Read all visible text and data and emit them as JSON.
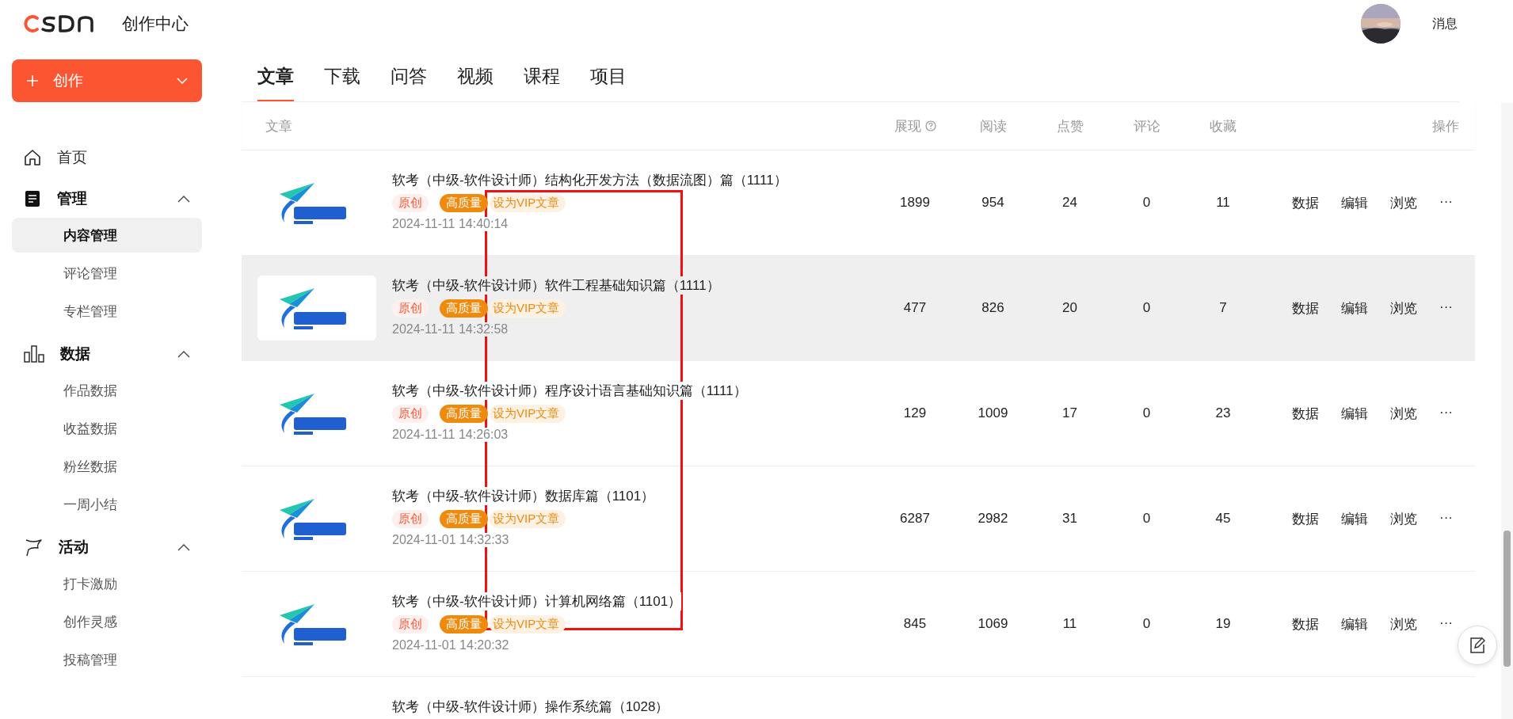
{
  "header": {
    "brand": "创作中心",
    "messages": "消息"
  },
  "create_button": {
    "label": "创作"
  },
  "sidebar": {
    "items": [
      {
        "label": "首页",
        "expanded": false
      },
      {
        "label": "管理",
        "expanded": true,
        "children": [
          {
            "label": "内容管理",
            "selected": true
          },
          {
            "label": "评论管理",
            "selected": false
          },
          {
            "label": "专栏管理",
            "selected": false
          }
        ]
      },
      {
        "label": "数据",
        "expanded": true,
        "children": [
          {
            "label": "作品数据",
            "selected": false
          },
          {
            "label": "收益数据",
            "selected": false
          },
          {
            "label": "粉丝数据",
            "selected": false
          },
          {
            "label": "一周小结",
            "selected": false
          }
        ]
      },
      {
        "label": "活动",
        "expanded": true,
        "children": [
          {
            "label": "打卡激励",
            "selected": false
          },
          {
            "label": "创作灵感",
            "selected": false
          },
          {
            "label": "投稿管理",
            "selected": false
          }
        ]
      }
    ]
  },
  "tabs": [
    {
      "label": "文章",
      "selected": true
    },
    {
      "label": "下载",
      "selected": false
    },
    {
      "label": "问答",
      "selected": false
    },
    {
      "label": "视频",
      "selected": false
    },
    {
      "label": "课程",
      "selected": false
    },
    {
      "label": "项目",
      "selected": false
    }
  ],
  "table": {
    "columns": [
      "文章",
      "展现",
      "阅读",
      "点赞",
      "评论",
      "收藏",
      "操作"
    ],
    "rows": [
      {
        "title": "软考（中级-软件设计师）结构化开发方法（数据流图）篇（1111）",
        "tags": [
          {
            "label": "原创",
            "kind": "original"
          },
          {
            "label": "高质量",
            "kind": "quality"
          },
          {
            "label": "设为VIP文章",
            "kind": "vip"
          }
        ],
        "date": "2024-11-11 14:40:14",
        "views": "1899",
        "reads": "954",
        "likes": "24",
        "comments": "0",
        "favorites": "11",
        "actions": [
          "数据",
          "编辑",
          "浏览",
          "···"
        ],
        "highlighted": false
      },
      {
        "title": "软考（中级-软件设计师）软件工程基础知识篇（1111）",
        "tags": [
          {
            "label": "原创",
            "kind": "original"
          },
          {
            "label": "高质量",
            "kind": "quality"
          },
          {
            "label": "设为VIP文章",
            "kind": "vip"
          }
        ],
        "date": "2024-11-11 14:32:58",
        "views": "477",
        "reads": "826",
        "likes": "20",
        "comments": "0",
        "favorites": "7",
        "actions": [
          "数据",
          "编辑",
          "浏览",
          "···"
        ],
        "highlighted": true
      },
      {
        "title": "软考（中级-软件设计师）程序设计语言基础知识篇（1111）",
        "tags": [
          {
            "label": "原创",
            "kind": "original"
          },
          {
            "label": "高质量",
            "kind": "quality"
          },
          {
            "label": "设为VIP文章",
            "kind": "vip"
          }
        ],
        "date": "2024-11-11 14:26:03",
        "views": "129",
        "reads": "1009",
        "likes": "17",
        "comments": "0",
        "favorites": "23",
        "actions": [
          "数据",
          "编辑",
          "浏览",
          "···"
        ],
        "highlighted": false
      },
      {
        "title": "软考（中级-软件设计师）数据库篇（1101）",
        "tags": [
          {
            "label": "原创",
            "kind": "original"
          },
          {
            "label": "高质量",
            "kind": "quality"
          },
          {
            "label": "设为VIP文章",
            "kind": "vip"
          }
        ],
        "date": "2024-11-01 14:32:33",
        "views": "6287",
        "reads": "2982",
        "likes": "31",
        "comments": "0",
        "favorites": "45",
        "actions": [
          "数据",
          "编辑",
          "浏览",
          "···"
        ],
        "highlighted": false
      },
      {
        "title": "软考（中级-软件设计师）计算机网络篇（1101）",
        "tags": [
          {
            "label": "原创",
            "kind": "original"
          },
          {
            "label": "高质量",
            "kind": "quality"
          },
          {
            "label": "设为VIP文章",
            "kind": "vip"
          }
        ],
        "date": "2024-11-01 14:20:32",
        "views": "845",
        "reads": "1069",
        "likes": "11",
        "comments": "0",
        "favorites": "19",
        "actions": [
          "数据",
          "编辑",
          "浏览",
          "···"
        ],
        "highlighted": false
      },
      {
        "title": "软考（中级-软件设计师）操作系统篇（1028）"
      }
    ]
  }
}
